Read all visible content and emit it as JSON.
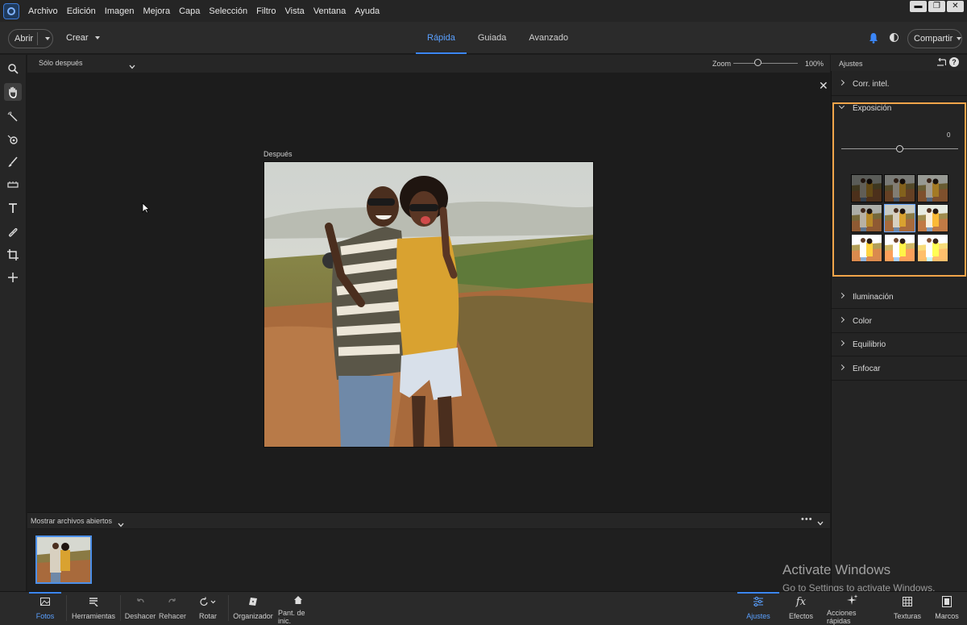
{
  "menubar": {
    "items": [
      "Archivo",
      "Edición",
      "Imagen",
      "Mejora",
      "Capa",
      "Selección",
      "Filtro",
      "Vista",
      "Ventana",
      "Ayuda"
    ],
    "window_controls": {
      "minimize": "▬",
      "restore": "❐",
      "close": "✕"
    }
  },
  "modebar": {
    "open_label": "Abrir",
    "create_label": "Crear",
    "tabs": [
      {
        "label": "Rápida",
        "active": true
      },
      {
        "label": "Guiada",
        "active": false
      },
      {
        "label": "Avanzado",
        "active": false
      }
    ],
    "share_label": "Compartir"
  },
  "view": {
    "view_mode": "Sólo después",
    "zoom_label": "Zoom",
    "zoom_value": "100%",
    "zoom_fraction": 0.33,
    "close_glyph": "✕",
    "canvas_label": "Después"
  },
  "photo_bin": {
    "label": "Mostrar archivos abiertos",
    "more_glyph": "•••"
  },
  "panel": {
    "title": "Ajustes",
    "sections_top": [
      "Corr. intel."
    ],
    "exposure": {
      "label": "Exposición",
      "value": "0",
      "slider_fraction": 0.5
    },
    "sections_bottom": [
      "Iluminación",
      "Color",
      "Equilibrio",
      "Enfocar"
    ]
  },
  "bottom_left": [
    {
      "label": "Fotos",
      "icon": "photos-icon",
      "active": true
    },
    {
      "label": "Herramientas",
      "icon": "tools-icon",
      "active": false
    },
    {
      "label": "Deshacer",
      "icon": "undo-icon",
      "active": false
    },
    {
      "label": "Rehacer",
      "icon": "redo-icon",
      "active": false
    },
    {
      "label": "Rotar",
      "icon": "rotate-icon",
      "active": false
    },
    {
      "label": "Organizador",
      "icon": "organizer-icon",
      "active": false
    },
    {
      "label": "Pant. de inic.",
      "icon": "home-icon",
      "active": false
    }
  ],
  "bottom_right": [
    {
      "label": "Ajustes",
      "icon": "sliders-icon",
      "active": true
    },
    {
      "label": "Efectos",
      "icon": "fx-icon",
      "active": false
    },
    {
      "label": "Acciones rápidas",
      "icon": "sparkle-icon",
      "active": false
    },
    {
      "label": "Texturas",
      "icon": "texture-icon",
      "active": false
    },
    {
      "label": "Marcos",
      "icon": "frame-icon",
      "active": false
    }
  ],
  "watermark": {
    "title": "Activate Windows",
    "subtitle": "Go to Settings to activate Windows."
  },
  "colors": {
    "accent": "#3b86f7",
    "highlight_border": "#f2a54a"
  }
}
